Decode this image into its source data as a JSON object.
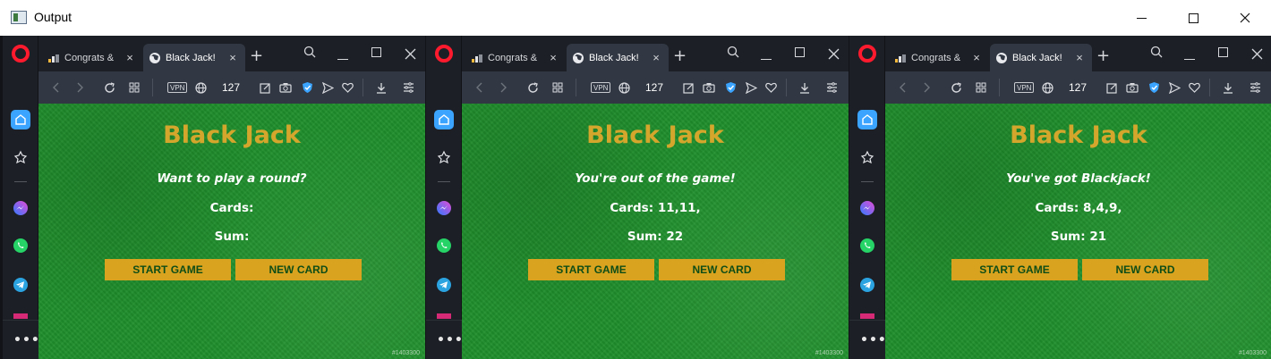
{
  "window": {
    "title": "Output"
  },
  "panels": [
    {
      "tabs": {
        "inactive": "Congrats & ",
        "active": "Black Jack!"
      },
      "address_bar": {
        "vpn": "VPN",
        "tab_count": "127"
      },
      "game": {
        "title": "Black Jack",
        "message": "Want to play a round?",
        "cards": "Cards:",
        "sum": "Sum:",
        "start_button": "START GAME",
        "new_card_button": "NEW CARD",
        "id_tag": "#1403300"
      }
    },
    {
      "tabs": {
        "inactive": "Congrats & ",
        "active": "Black Jack!"
      },
      "address_bar": {
        "vpn": "VPN",
        "tab_count": "127"
      },
      "game": {
        "title": "Black Jack",
        "message": "You're out of the game!",
        "cards": "Cards: 11,11,",
        "sum": "Sum: 22",
        "start_button": "START GAME",
        "new_card_button": "NEW CARD",
        "id_tag": "#1403300"
      }
    },
    {
      "tabs": {
        "inactive": "Congrats & ",
        "active": "Black Jack!"
      },
      "address_bar": {
        "vpn": "VPN",
        "tab_count": "127"
      },
      "game": {
        "title": "Black Jack",
        "message": "You've got Blackjack!",
        "cards": "Cards: 8,4,9,",
        "sum": "Sum: 21",
        "start_button": "START GAME",
        "new_card_button": "NEW CARD",
        "id_tag": "#1403300"
      }
    }
  ],
  "icons": {
    "sidebar": [
      "home-icon",
      "pin-icon",
      "messenger-icon",
      "whatsapp-icon",
      "telegram-icon",
      "instagram-icon",
      "more-icon"
    ],
    "toolbar": [
      "back-icon",
      "forward-icon",
      "reload-icon",
      "tab-grid-icon",
      "globe-icon",
      "snapshot-icon",
      "camera-icon",
      "shield-icon",
      "send-icon",
      "heart-icon",
      "download-icon",
      "settings-icon"
    ]
  },
  "colors": {
    "felt_green": "#1f8f2c",
    "title_gold": "#d4a72c",
    "button_gold": "#d9a31f",
    "button_text": "#0f4d16",
    "browser_dark": "#1c1f26",
    "toolbar": "#323843"
  }
}
